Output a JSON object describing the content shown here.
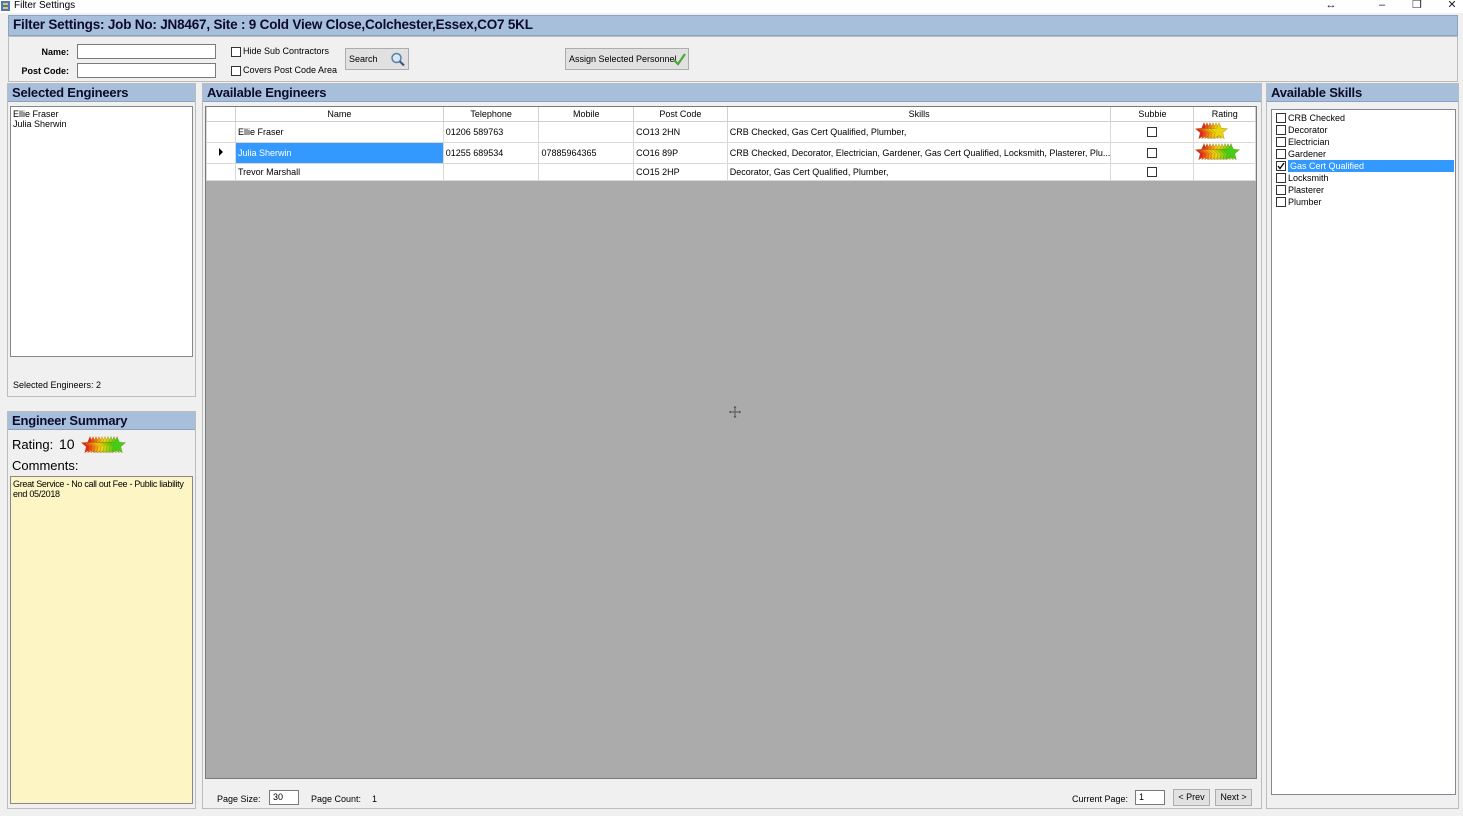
{
  "window": {
    "title": "Filter Settings"
  },
  "header": {
    "title": "Filter Settings: Job No: JN8467, Site : 9 Cold View Close,Colchester,Essex,CO7 5KL"
  },
  "filters": {
    "name_label": "Name:",
    "name_value": "",
    "postcode_label": "Post Code:",
    "postcode_value": "",
    "hide_sub_contractors_label": "Hide Sub Contractors",
    "covers_postcode_area_label": "Covers Post Code Area",
    "search_label": "Search",
    "assign_label": "Assign Selected Personnel"
  },
  "selected_engineers": {
    "title": "Selected Engineers",
    "items": [
      "Ellie Fraser",
      "Julia Sherwin"
    ],
    "count_label": "Selected Engineers:",
    "count": "2"
  },
  "summary": {
    "title": "Engineer Summary",
    "rating_label": "Rating:",
    "rating_value": "10",
    "comments_label": "Comments:",
    "comments": "Great Service - No call out Fee - Public liability end 05/2018"
  },
  "available_engineers": {
    "title": "Available Engineers",
    "columns": [
      "Name",
      "Telephone",
      "Mobile",
      "Post Code",
      "Skills",
      "Subbie",
      "Rating"
    ],
    "rows": [
      {
        "name": "Ellie Fraser",
        "telephone": "01206 589763",
        "mobile": "",
        "postcode": "CO13 2HN",
        "skills": "CRB Checked, Gas Cert Qualified, Plumber,",
        "rating": 6
      },
      {
        "name": "Julia Sherwin",
        "telephone": "01255 689534",
        "mobile": "07885964365",
        "postcode": "CO16 89P",
        "skills": "CRB Checked, Decorator, Electrician, Gardener, Gas Cert Qualified, Locksmith, Plasterer, Plu...",
        "rating": 10
      },
      {
        "name": "Trevor Marshall",
        "telephone": "",
        "mobile": "",
        "postcode": "CO15 2HP",
        "skills": "Decorator, Gas Cert Qualified, Plumber,",
        "rating": 0
      }
    ]
  },
  "available_skills": {
    "title": "Available Skills",
    "items": [
      {
        "label": "CRB Checked",
        "checked": false
      },
      {
        "label": "Decorator",
        "checked": false
      },
      {
        "label": "Electrician",
        "checked": false
      },
      {
        "label": "Gardener",
        "checked": false
      },
      {
        "label": "Gas Cert Qualified",
        "checked": true
      },
      {
        "label": "Locksmith",
        "checked": false
      },
      {
        "label": "Plasterer",
        "checked": false
      },
      {
        "label": "Plumber",
        "checked": false
      }
    ]
  },
  "paging": {
    "page_size_label": "Page Size:",
    "page_size": "30",
    "page_count_label": "Page Count:",
    "page_count": "1",
    "current_page_label": "Current Page:",
    "current_page": "1",
    "prev_label": "< Prev",
    "next_label": "Next >"
  },
  "colors": {
    "header": "#a8bfdc",
    "selection": "#3399ff",
    "comments_bg": "#fdf5c4",
    "grid_bg": "#ababab"
  }
}
